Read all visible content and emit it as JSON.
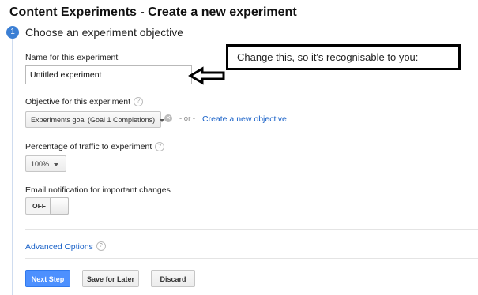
{
  "page": {
    "title": "Content Experiments - Create a new experiment"
  },
  "step": {
    "number": "1",
    "title": "Choose an experiment objective"
  },
  "name_field": {
    "label": "Name for this experiment",
    "value": "Untitled experiment"
  },
  "callout": {
    "text": "Change this, so it's recognisable to you:"
  },
  "objective": {
    "label": "Objective for this experiment",
    "selected": "Experiments goal (Goal 1 Completions)",
    "or_text": "- or -",
    "create_link": "Create a new objective"
  },
  "traffic": {
    "label": "Percentage of traffic to experiment",
    "selected": "100%"
  },
  "email": {
    "label": "Email notification for important changes",
    "toggle_state": "OFF"
  },
  "advanced": {
    "label": "Advanced Options"
  },
  "buttons": {
    "next": "Next Step",
    "save": "Save for Later",
    "discard": "Discard"
  },
  "icons": {
    "help": "help-icon",
    "clear": "clear-icon",
    "arrow": "left-arrow-icon",
    "caret": "chevron-down-icon"
  },
  "colors": {
    "accent": "#3b7fd4",
    "primary_button": "#4d90fe",
    "link": "#1a62c8"
  }
}
